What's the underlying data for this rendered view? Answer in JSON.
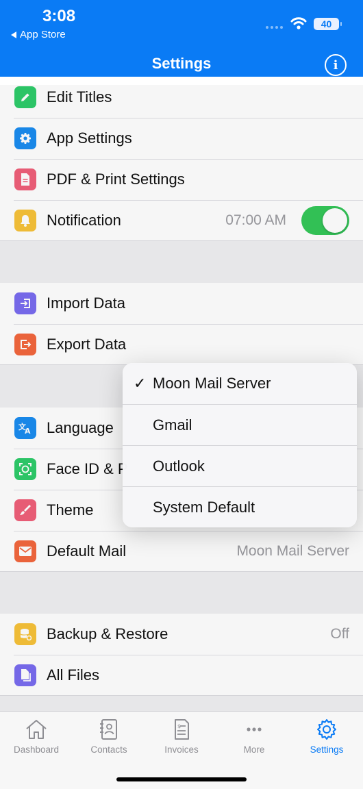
{
  "status_bar": {
    "time": "3:08",
    "back_app": "App Store",
    "battery": "40"
  },
  "header": {
    "title": "Settings"
  },
  "groups": {
    "general": [
      {
        "label": "Edit Titles",
        "icon": "pencil-icon",
        "color": "#2ecc6a"
      },
      {
        "label": "App Settings",
        "icon": "gear-icon",
        "color": "#1a8cf0"
      },
      {
        "label": "PDF & Print Settings",
        "icon": "document-icon",
        "color": "#f0607a"
      },
      {
        "label": "Notification",
        "icon": "bell-icon",
        "color": "#f7c23a",
        "value": "07:00 AM",
        "toggle": true
      }
    ],
    "data": [
      {
        "label": "Import Data",
        "icon": "import-icon",
        "color": "#7a6cf0"
      },
      {
        "label": "Export Data",
        "icon": "export-icon",
        "color": "#f3673e"
      }
    ],
    "preferences": [
      {
        "label": "Language",
        "icon": "translate-icon",
        "color": "#1a8cf0"
      },
      {
        "label": "Face ID & P",
        "icon": "face-id-icon",
        "color": "#2ecc6a"
      },
      {
        "label": "Theme",
        "icon": "brush-icon",
        "color": "#f0607a"
      },
      {
        "label": "Default Mail",
        "icon": "mail-icon",
        "color": "#f3673e",
        "value": "Moon Mail Server"
      }
    ],
    "storage": [
      {
        "label": "Backup & Restore",
        "icon": "database-icon",
        "color": "#f7c23a",
        "value": "Off"
      },
      {
        "label": "All Files",
        "icon": "files-icon",
        "color": "#7a6cf0"
      }
    ]
  },
  "mail_menu": {
    "selected": "Moon Mail Server",
    "options": [
      "Moon Mail Server",
      "Gmail",
      "Outlook",
      "System Default"
    ]
  },
  "tabbar": {
    "active": "Settings",
    "tabs": [
      {
        "label": "Dashboard",
        "icon": "house-icon"
      },
      {
        "label": "Contacts",
        "icon": "address-book-icon"
      },
      {
        "label": "Invoices",
        "icon": "invoice-icon"
      },
      {
        "label": "More",
        "icon": "ellipsis-icon"
      },
      {
        "label": "Settings",
        "icon": "gear-icon"
      }
    ]
  },
  "colors": {
    "accent": "#0a7bf5",
    "toggle_on": "#34c759"
  }
}
